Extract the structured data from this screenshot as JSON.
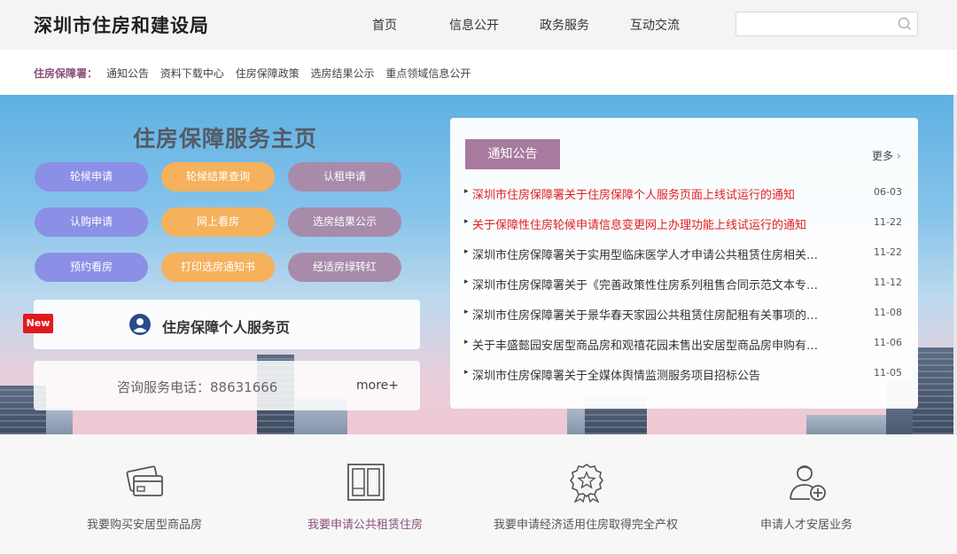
{
  "header": {
    "site_title": "深圳市住房和建设局",
    "nav": [
      "首页",
      "信息公开",
      "政务服务",
      "互动交流"
    ],
    "search_placeholder": ""
  },
  "subnav": {
    "label": "住房保障署：",
    "links": [
      "通知公告",
      "资料下载中心",
      "住房保障政策",
      "选房结果公示",
      "重点领域信息公开"
    ]
  },
  "panel": {
    "title": "住房保障服务主页",
    "buttons": [
      {
        "label": "轮候申请",
        "color": "#8b8fe6"
      },
      {
        "label": "轮候结果查询",
        "color": "#f5b15c"
      },
      {
        "label": "认租申请",
        "color": "#a88baa"
      },
      {
        "label": "认购申请",
        "color": "#8b8fe6"
      },
      {
        "label": "网上看房",
        "color": "#f5b15c"
      },
      {
        "label": "选房结果公示",
        "color": "#a88baa"
      },
      {
        "label": "预约看房",
        "color": "#8b8fe6"
      },
      {
        "label": "打印选房通知书",
        "color": "#f5b15c"
      },
      {
        "label": "经适房绿转红",
        "color": "#a88baa"
      }
    ],
    "new_badge": "New",
    "service_label": "住房保障个人服务页",
    "phone_text": "咨询服务电话：88631666",
    "phone_more": "more+"
  },
  "notices": {
    "tab_label": "通知公告",
    "more_label": "更多",
    "items": [
      {
        "title": "深圳市住房保障署关于住房保障个人服务页面上线试运行的通知",
        "date": "06-03",
        "highlight": true
      },
      {
        "title": "关于保障性住房轮候申请信息变更网上办理功能上线试运行的通知",
        "date": "11-22",
        "highlight": true
      },
      {
        "title": "深圳市住房保障署关于实用型临床医学人才申请公共租赁住房相关…",
        "date": "11-22",
        "highlight": false
      },
      {
        "title": "深圳市住房保障署关于《完善政策性住房系列租售合同示范文本专…",
        "date": "11-12",
        "highlight": false
      },
      {
        "title": "深圳市住房保障署关于景华春天家园公共租赁住房配租有关事项的…",
        "date": "11-08",
        "highlight": false
      },
      {
        "title": "关于丰盛懿园安居型商品房和观禧花园未售出安居型商品房申购有…",
        "date": "11-06",
        "highlight": false
      },
      {
        "title": "深圳市住房保障署关于全媒体舆情监测服务项目招标公告",
        "date": "11-05",
        "highlight": false
      }
    ]
  },
  "bottom": {
    "items": [
      {
        "label": "我要购买安居型商品房",
        "icon": "card-icon",
        "highlight": false
      },
      {
        "label": "我要申请公共租赁住房",
        "icon": "window-icon",
        "highlight": true
      },
      {
        "label": "我要申请经济适用住房取得完全产权",
        "icon": "award-icon",
        "highlight": false
      },
      {
        "label": "申请人才安居业务",
        "icon": "user-add-icon",
        "highlight": false
      }
    ]
  },
  "colors": {
    "accent": "#8a4e7a",
    "notice_tab": "#a77a9e",
    "highlight_text": "#e02020"
  }
}
